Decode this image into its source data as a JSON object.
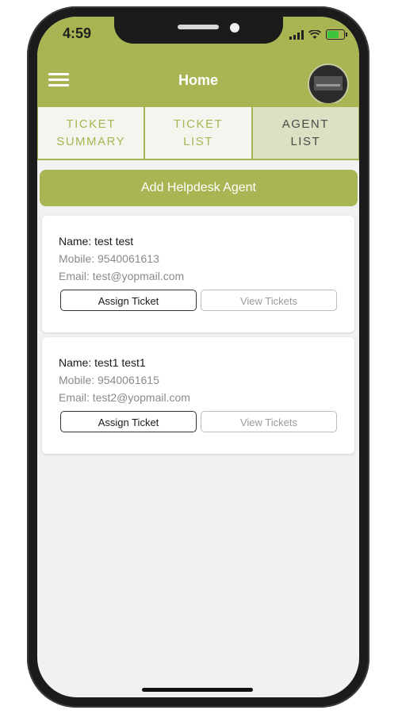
{
  "status_bar": {
    "time": "4:59"
  },
  "header": {
    "title": "Home"
  },
  "tabs": [
    {
      "line1": "TICKET",
      "line2": "SUMMARY",
      "active": false
    },
    {
      "line1": "TICKET",
      "line2": "LIST",
      "active": false
    },
    {
      "line1": "AGENT",
      "line2": "LIST",
      "active": true
    }
  ],
  "add_button": {
    "label": "Add Helpdesk Agent"
  },
  "agents": [
    {
      "name": "Name: test test",
      "mobile": "Mobile: 9540061613",
      "email": "Email: test@yopmail.com",
      "assign_label": "Assign Ticket",
      "view_label": "View Tickets"
    },
    {
      "name": "Name: test1 test1",
      "mobile": "Mobile: 9540061615",
      "email": "Email: test2@yopmail.com",
      "assign_label": "Assign Ticket",
      "view_label": "View Tickets"
    }
  ],
  "colors": {
    "accent": "#a9b552",
    "active_tab": "#dde0c3",
    "background": "#f1f1f1"
  },
  "icons": [
    "hamburger-menu-icon",
    "signal-icon",
    "wifi-icon",
    "battery-icon",
    "avatar"
  ]
}
